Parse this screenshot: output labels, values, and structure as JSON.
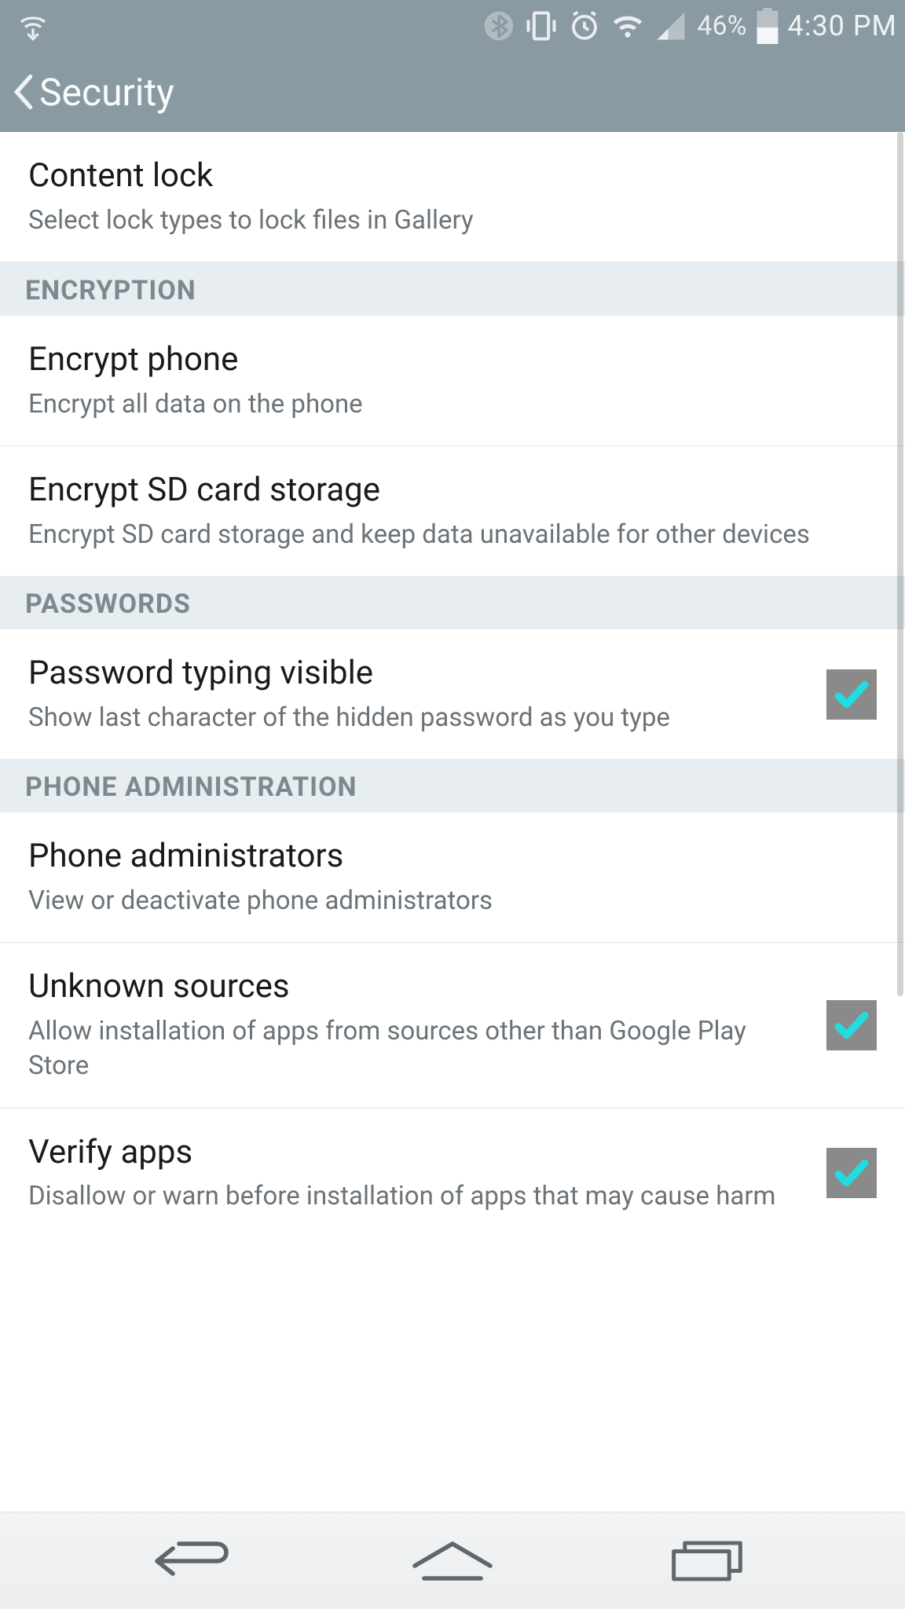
{
  "status": {
    "battery_pct": "46%",
    "time": "4:30 PM"
  },
  "header": {
    "title": "Security"
  },
  "sections": {
    "s0": {
      "i0": {
        "title": "Content lock",
        "desc": "Select lock types to lock files in Gallery"
      }
    },
    "h1": "ENCRYPTION",
    "s1": {
      "i0": {
        "title": "Encrypt phone",
        "desc": "Encrypt all data on the phone"
      },
      "i1": {
        "title": "Encrypt SD card storage",
        "desc": "Encrypt SD card storage and keep data unavailable for other devices"
      }
    },
    "h2": "PASSWORDS",
    "s2": {
      "i0": {
        "title": "Password typing visible",
        "desc": "Show last character of the hidden password as you type"
      }
    },
    "h3": "PHONE ADMINISTRATION",
    "s3": {
      "i0": {
        "title": "Phone administrators",
        "desc": "View or deactivate phone administrators"
      },
      "i1": {
        "title": "Unknown sources",
        "desc": "Allow installation of apps from sources other than Google Play Store"
      },
      "i2": {
        "title": "Verify apps",
        "desc": "Disallow or warn before installation of apps that may cause harm"
      }
    }
  }
}
